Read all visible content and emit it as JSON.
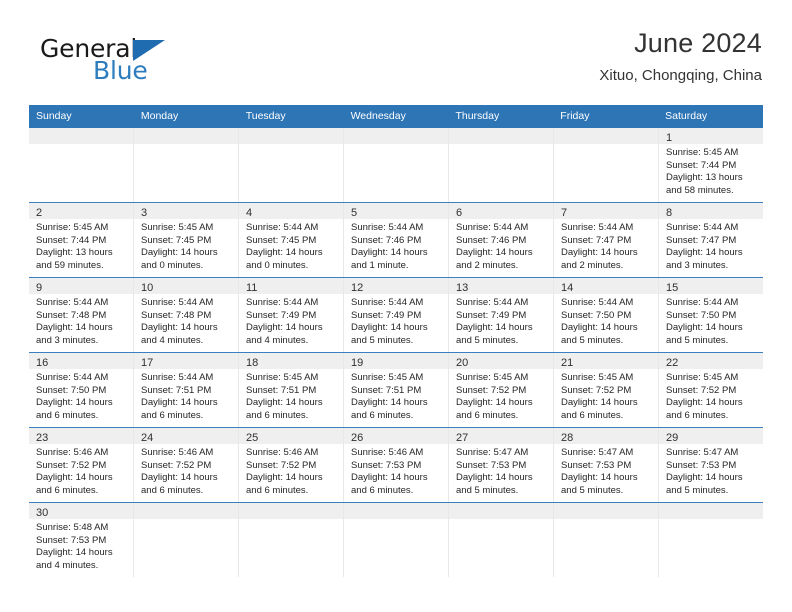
{
  "brand": {
    "name_part1": "General",
    "name_part2": "Blue"
  },
  "header": {
    "title": "June 2024",
    "subtitle": "Xituo, Chongqing, China"
  },
  "weekdays": [
    "Sunday",
    "Monday",
    "Tuesday",
    "Wednesday",
    "Thursday",
    "Friday",
    "Saturday"
  ],
  "colors": {
    "header_blue": "#2e75b6",
    "row_divider_blue": "#3b7fc0",
    "day_band_gray": "#efefef",
    "logo_blue": "#2e7ebf"
  },
  "weeks": [
    [
      {
        "day": "",
        "empty": true
      },
      {
        "day": "",
        "empty": true
      },
      {
        "day": "",
        "empty": true
      },
      {
        "day": "",
        "empty": true
      },
      {
        "day": "",
        "empty": true
      },
      {
        "day": "",
        "empty": true
      },
      {
        "day": "1",
        "sunrise": "Sunrise: 5:45 AM",
        "sunset": "Sunset: 7:44 PM",
        "daylight_1": "Daylight: 13 hours",
        "daylight_2": "and 58 minutes."
      }
    ],
    [
      {
        "day": "2",
        "sunrise": "Sunrise: 5:45 AM",
        "sunset": "Sunset: 7:44 PM",
        "daylight_1": "Daylight: 13 hours",
        "daylight_2": "and 59 minutes."
      },
      {
        "day": "3",
        "sunrise": "Sunrise: 5:45 AM",
        "sunset": "Sunset: 7:45 PM",
        "daylight_1": "Daylight: 14 hours",
        "daylight_2": "and 0 minutes."
      },
      {
        "day": "4",
        "sunrise": "Sunrise: 5:44 AM",
        "sunset": "Sunset: 7:45 PM",
        "daylight_1": "Daylight: 14 hours",
        "daylight_2": "and 0 minutes."
      },
      {
        "day": "5",
        "sunrise": "Sunrise: 5:44 AM",
        "sunset": "Sunset: 7:46 PM",
        "daylight_1": "Daylight: 14 hours",
        "daylight_2": "and 1 minute."
      },
      {
        "day": "6",
        "sunrise": "Sunrise: 5:44 AM",
        "sunset": "Sunset: 7:46 PM",
        "daylight_1": "Daylight: 14 hours",
        "daylight_2": "and 2 minutes."
      },
      {
        "day": "7",
        "sunrise": "Sunrise: 5:44 AM",
        "sunset": "Sunset: 7:47 PM",
        "daylight_1": "Daylight: 14 hours",
        "daylight_2": "and 2 minutes."
      },
      {
        "day": "8",
        "sunrise": "Sunrise: 5:44 AM",
        "sunset": "Sunset: 7:47 PM",
        "daylight_1": "Daylight: 14 hours",
        "daylight_2": "and 3 minutes."
      }
    ],
    [
      {
        "day": "9",
        "sunrise": "Sunrise: 5:44 AM",
        "sunset": "Sunset: 7:48 PM",
        "daylight_1": "Daylight: 14 hours",
        "daylight_2": "and 3 minutes."
      },
      {
        "day": "10",
        "sunrise": "Sunrise: 5:44 AM",
        "sunset": "Sunset: 7:48 PM",
        "daylight_1": "Daylight: 14 hours",
        "daylight_2": "and 4 minutes."
      },
      {
        "day": "11",
        "sunrise": "Sunrise: 5:44 AM",
        "sunset": "Sunset: 7:49 PM",
        "daylight_1": "Daylight: 14 hours",
        "daylight_2": "and 4 minutes."
      },
      {
        "day": "12",
        "sunrise": "Sunrise: 5:44 AM",
        "sunset": "Sunset: 7:49 PM",
        "daylight_1": "Daylight: 14 hours",
        "daylight_2": "and 5 minutes."
      },
      {
        "day": "13",
        "sunrise": "Sunrise: 5:44 AM",
        "sunset": "Sunset: 7:49 PM",
        "daylight_1": "Daylight: 14 hours",
        "daylight_2": "and 5 minutes."
      },
      {
        "day": "14",
        "sunrise": "Sunrise: 5:44 AM",
        "sunset": "Sunset: 7:50 PM",
        "daylight_1": "Daylight: 14 hours",
        "daylight_2": "and 5 minutes."
      },
      {
        "day": "15",
        "sunrise": "Sunrise: 5:44 AM",
        "sunset": "Sunset: 7:50 PM",
        "daylight_1": "Daylight: 14 hours",
        "daylight_2": "and 5 minutes."
      }
    ],
    [
      {
        "day": "16",
        "sunrise": "Sunrise: 5:44 AM",
        "sunset": "Sunset: 7:50 PM",
        "daylight_1": "Daylight: 14 hours",
        "daylight_2": "and 6 minutes."
      },
      {
        "day": "17",
        "sunrise": "Sunrise: 5:44 AM",
        "sunset": "Sunset: 7:51 PM",
        "daylight_1": "Daylight: 14 hours",
        "daylight_2": "and 6 minutes."
      },
      {
        "day": "18",
        "sunrise": "Sunrise: 5:45 AM",
        "sunset": "Sunset: 7:51 PM",
        "daylight_1": "Daylight: 14 hours",
        "daylight_2": "and 6 minutes."
      },
      {
        "day": "19",
        "sunrise": "Sunrise: 5:45 AM",
        "sunset": "Sunset: 7:51 PM",
        "daylight_1": "Daylight: 14 hours",
        "daylight_2": "and 6 minutes."
      },
      {
        "day": "20",
        "sunrise": "Sunrise: 5:45 AM",
        "sunset": "Sunset: 7:52 PM",
        "daylight_1": "Daylight: 14 hours",
        "daylight_2": "and 6 minutes."
      },
      {
        "day": "21",
        "sunrise": "Sunrise: 5:45 AM",
        "sunset": "Sunset: 7:52 PM",
        "daylight_1": "Daylight: 14 hours",
        "daylight_2": "and 6 minutes."
      },
      {
        "day": "22",
        "sunrise": "Sunrise: 5:45 AM",
        "sunset": "Sunset: 7:52 PM",
        "daylight_1": "Daylight: 14 hours",
        "daylight_2": "and 6 minutes."
      }
    ],
    [
      {
        "day": "23",
        "sunrise": "Sunrise: 5:46 AM",
        "sunset": "Sunset: 7:52 PM",
        "daylight_1": "Daylight: 14 hours",
        "daylight_2": "and 6 minutes."
      },
      {
        "day": "24",
        "sunrise": "Sunrise: 5:46 AM",
        "sunset": "Sunset: 7:52 PM",
        "daylight_1": "Daylight: 14 hours",
        "daylight_2": "and 6 minutes."
      },
      {
        "day": "25",
        "sunrise": "Sunrise: 5:46 AM",
        "sunset": "Sunset: 7:52 PM",
        "daylight_1": "Daylight: 14 hours",
        "daylight_2": "and 6 minutes."
      },
      {
        "day": "26",
        "sunrise": "Sunrise: 5:46 AM",
        "sunset": "Sunset: 7:53 PM",
        "daylight_1": "Daylight: 14 hours",
        "daylight_2": "and 6 minutes."
      },
      {
        "day": "27",
        "sunrise": "Sunrise: 5:47 AM",
        "sunset": "Sunset: 7:53 PM",
        "daylight_1": "Daylight: 14 hours",
        "daylight_2": "and 5 minutes."
      },
      {
        "day": "28",
        "sunrise": "Sunrise: 5:47 AM",
        "sunset": "Sunset: 7:53 PM",
        "daylight_1": "Daylight: 14 hours",
        "daylight_2": "and 5 minutes."
      },
      {
        "day": "29",
        "sunrise": "Sunrise: 5:47 AM",
        "sunset": "Sunset: 7:53 PM",
        "daylight_1": "Daylight: 14 hours",
        "daylight_2": "and 5 minutes."
      }
    ],
    [
      {
        "day": "30",
        "sunrise": "Sunrise: 5:48 AM",
        "sunset": "Sunset: 7:53 PM",
        "daylight_1": "Daylight: 14 hours",
        "daylight_2": "and 4 minutes."
      },
      {
        "day": "",
        "empty": true
      },
      {
        "day": "",
        "empty": true
      },
      {
        "day": "",
        "empty": true
      },
      {
        "day": "",
        "empty": true
      },
      {
        "day": "",
        "empty": true
      },
      {
        "day": "",
        "empty": true
      }
    ]
  ]
}
